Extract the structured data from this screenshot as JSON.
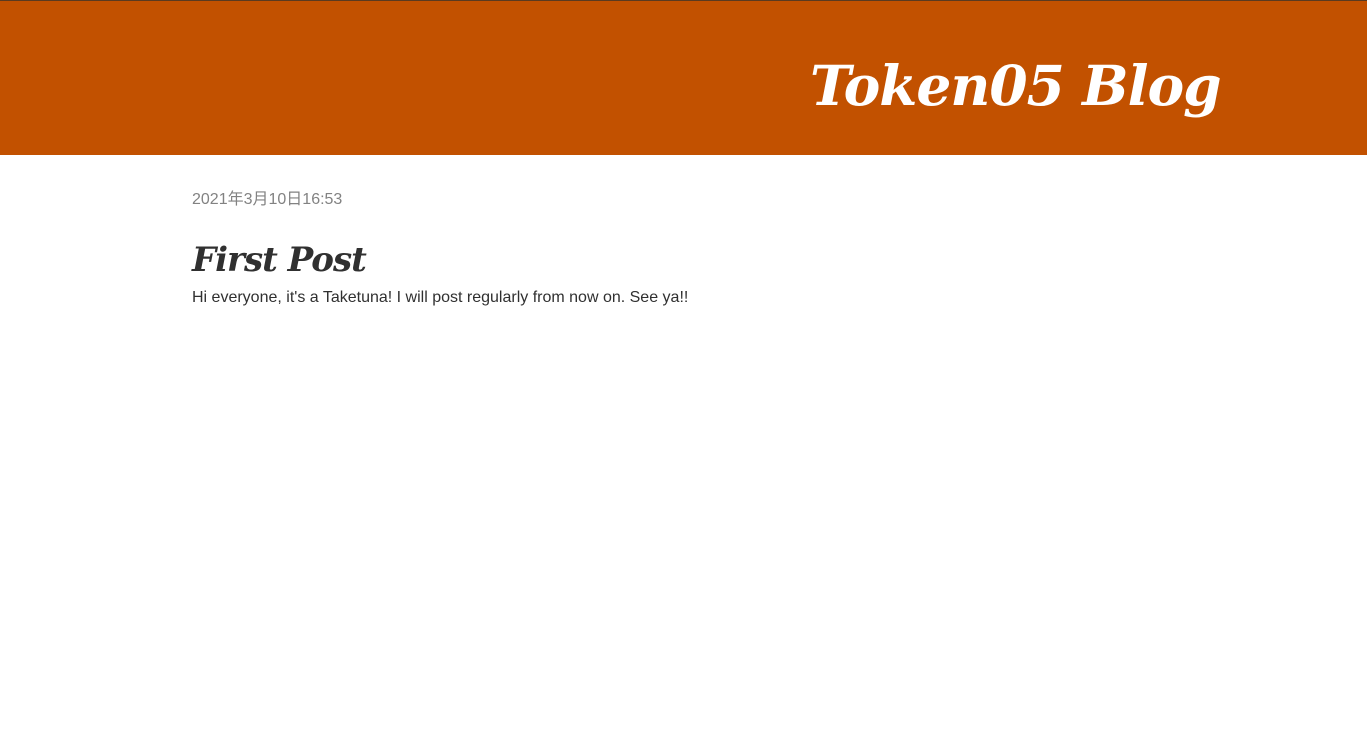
{
  "header": {
    "site_title": "Token05 Blog",
    "background_color": "#c25100"
  },
  "post": {
    "date": "2021年3月10日16:53",
    "title": "First Post",
    "body": "Hi everyone, it's a Taketuna! I will post regularly from now on. See ya!!"
  }
}
